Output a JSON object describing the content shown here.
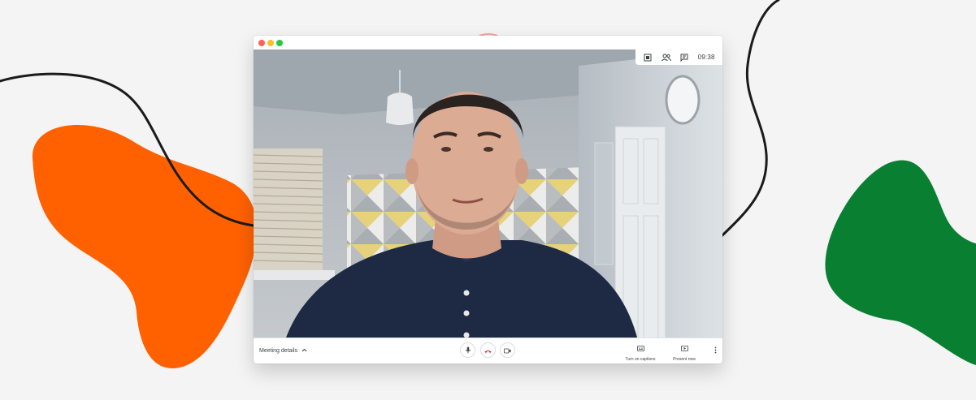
{
  "window": {
    "traffic_lights": {
      "close": "#ff5f57",
      "minimize": "#febc2e",
      "zoom": "#28c840"
    }
  },
  "top_bar": {
    "icons": [
      "layout-icon",
      "participants-icon",
      "chat-icon"
    ],
    "clock": "09:38"
  },
  "controls": {
    "meeting_details_label": "Meeting details",
    "captions_label": "Turn on captions",
    "present_label": "Present now",
    "end_call_color": "#d93025"
  },
  "decor": {
    "orange_blob_color": "#ff6100",
    "green_blob_color": "#087f31"
  }
}
